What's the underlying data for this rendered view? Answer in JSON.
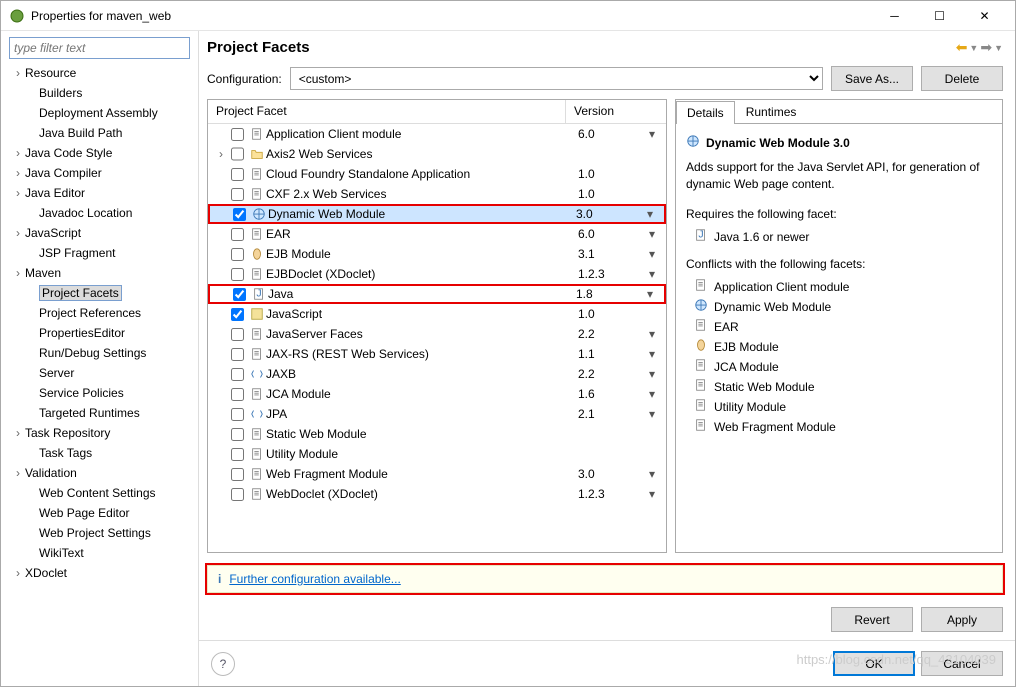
{
  "window": {
    "title": "Properties for maven_web"
  },
  "filter": {
    "placeholder": "type filter text"
  },
  "sidebar": [
    {
      "label": "Resource",
      "children": true
    },
    {
      "label": "Builders"
    },
    {
      "label": "Deployment Assembly"
    },
    {
      "label": "Java Build Path"
    },
    {
      "label": "Java Code Style",
      "children": true
    },
    {
      "label": "Java Compiler",
      "children": true
    },
    {
      "label": "Java Editor",
      "children": true
    },
    {
      "label": "Javadoc Location"
    },
    {
      "label": "JavaScript",
      "children": true
    },
    {
      "label": "JSP Fragment"
    },
    {
      "label": "Maven",
      "children": true
    },
    {
      "label": "Project Facets",
      "selected": true
    },
    {
      "label": "Project References"
    },
    {
      "label": "PropertiesEditor"
    },
    {
      "label": "Run/Debug Settings"
    },
    {
      "label": "Server"
    },
    {
      "label": "Service Policies"
    },
    {
      "label": "Targeted Runtimes"
    },
    {
      "label": "Task Repository",
      "children": true
    },
    {
      "label": "Task Tags"
    },
    {
      "label": "Validation",
      "children": true
    },
    {
      "label": "Web Content Settings"
    },
    {
      "label": "Web Page Editor"
    },
    {
      "label": "Web Project Settings"
    },
    {
      "label": "WikiText"
    },
    {
      "label": "XDoclet",
      "children": true
    }
  ],
  "page_title": "Project Facets",
  "config": {
    "label": "Configuration:",
    "value": "<custom>",
    "saveas": "Save As...",
    "delete": "Delete"
  },
  "table_headers": {
    "name": "Project Facet",
    "version": "Version"
  },
  "facets": [
    {
      "name": "Application Client module",
      "version": "6.0",
      "dd": true,
      "checked": false,
      "icon": "doc"
    },
    {
      "name": "Axis2 Web Services",
      "version": "",
      "dd": false,
      "checked": false,
      "icon": "folder",
      "expandable": true
    },
    {
      "name": "Cloud Foundry Standalone Application",
      "version": "1.0",
      "dd": false,
      "checked": false,
      "icon": "doc"
    },
    {
      "name": "CXF 2.x Web Services",
      "version": "1.0",
      "dd": false,
      "checked": false,
      "icon": "doc"
    },
    {
      "name": "Dynamic Web Module",
      "version": "3.0",
      "dd": true,
      "checked": true,
      "icon": "globe",
      "selected": true,
      "highlight": true
    },
    {
      "name": "EAR",
      "version": "6.0",
      "dd": true,
      "checked": false,
      "icon": "doc"
    },
    {
      "name": "EJB Module",
      "version": "3.1",
      "dd": true,
      "checked": false,
      "icon": "bean"
    },
    {
      "name": "EJBDoclet (XDoclet)",
      "version": "1.2.3",
      "dd": true,
      "checked": false,
      "icon": "doc"
    },
    {
      "name": "Java",
      "version": "1.8",
      "dd": true,
      "checked": true,
      "icon": "java",
      "highlight": true
    },
    {
      "name": "JavaScript",
      "version": "1.0",
      "dd": false,
      "checked": true,
      "icon": "js"
    },
    {
      "name": "JavaServer Faces",
      "version": "2.2",
      "dd": true,
      "checked": false,
      "icon": "doc"
    },
    {
      "name": "JAX-RS (REST Web Services)",
      "version": "1.1",
      "dd": true,
      "checked": false,
      "icon": "doc"
    },
    {
      "name": "JAXB",
      "version": "2.2",
      "dd": true,
      "checked": false,
      "icon": "xml"
    },
    {
      "name": "JCA Module",
      "version": "1.6",
      "dd": true,
      "checked": false,
      "icon": "doc"
    },
    {
      "name": "JPA",
      "version": "2.1",
      "dd": true,
      "checked": false,
      "icon": "jpa"
    },
    {
      "name": "Static Web Module",
      "version": "",
      "dd": false,
      "checked": false,
      "icon": "doc"
    },
    {
      "name": "Utility Module",
      "version": "",
      "dd": false,
      "checked": false,
      "icon": "doc"
    },
    {
      "name": "Web Fragment Module",
      "version": "3.0",
      "dd": true,
      "checked": false,
      "icon": "doc"
    },
    {
      "name": "WebDoclet (XDoclet)",
      "version": "1.2.3",
      "dd": true,
      "checked": false,
      "icon": "doc"
    }
  ],
  "details": {
    "tabs": [
      "Details",
      "Runtimes"
    ],
    "title": "Dynamic Web Module 3.0",
    "description": "Adds support for the Java Servlet API, for generation of dynamic Web page content.",
    "requires_label": "Requires the following facet:",
    "requires": [
      {
        "label": "Java 1.6 or newer",
        "icon": "java"
      }
    ],
    "conflicts_label": "Conflicts with the following facets:",
    "conflicts": [
      {
        "label": "Application Client module",
        "icon": "doc"
      },
      {
        "label": "Dynamic Web Module",
        "icon": "globe"
      },
      {
        "label": "EAR",
        "icon": "doc"
      },
      {
        "label": "EJB Module",
        "icon": "bean"
      },
      {
        "label": "JCA Module",
        "icon": "doc"
      },
      {
        "label": "Static Web Module",
        "icon": "doc"
      },
      {
        "label": "Utility Module",
        "icon": "doc"
      },
      {
        "label": "Web Fragment Module",
        "icon": "doc"
      }
    ]
  },
  "link": {
    "text": "Further configuration available..."
  },
  "buttons": {
    "revert": "Revert",
    "apply": "Apply",
    "ok": "OK",
    "cancel": "Cancel"
  },
  "watermark": "https://blog.csdn.net/qq_43104039"
}
